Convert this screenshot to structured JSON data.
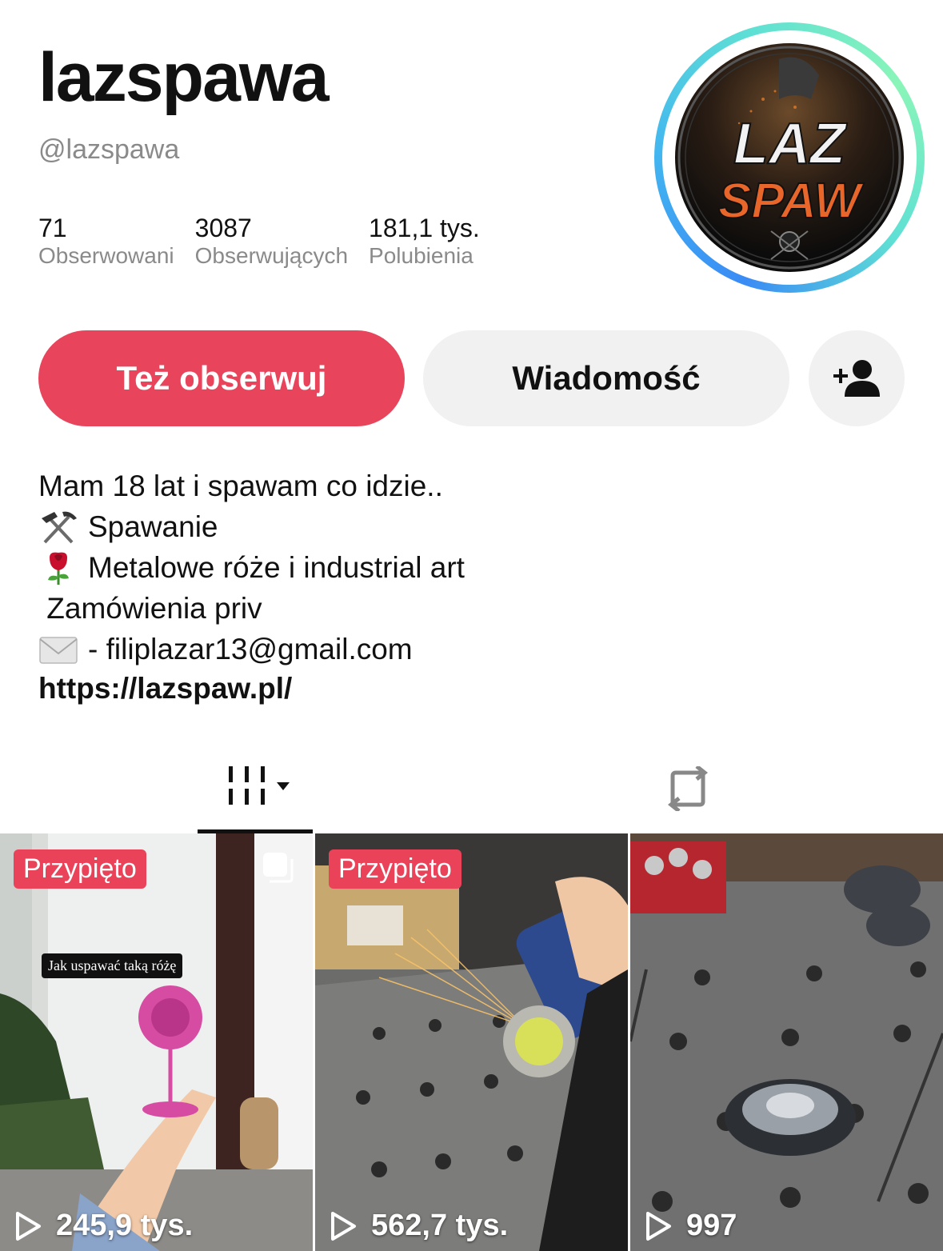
{
  "profile": {
    "display_name": "lazspawa",
    "handle": "@lazspawa",
    "avatar_text_top": "LAZ",
    "avatar_text_bottom": "SPAW"
  },
  "stats": [
    {
      "value": "71",
      "label": "Obserwowani"
    },
    {
      "value": "3087",
      "label": "Obserwujących"
    },
    {
      "value": "181,1 tys.",
      "label": "Polubienia"
    }
  ],
  "actions": {
    "follow_label": "Też obserwuj",
    "message_label": "Wiadomość",
    "add_friend_icon": "add-user-icon"
  },
  "bio": {
    "lines": [
      "Mam 18 lat i spawam co idzie..",
      "Spawanie",
      "Metalowe róże i industrial art",
      " Zamówienia priv",
      "- filiplazar13@gmail.com"
    ],
    "link": "https://lazspaw.pl/"
  },
  "tabs": {
    "videos_icon": "grid-icon",
    "reposts_icon": "repost-icon"
  },
  "videos": [
    {
      "pinned": "Przypięto",
      "views": "245,9 tys.",
      "caption": "Jak uspawać taką różę"
    },
    {
      "pinned": "Przypięto",
      "views": "562,7 tys."
    },
    {
      "views": "997"
    }
  ],
  "colors": {
    "accent": "#e8455c",
    "pinned_badge": "#ea4359",
    "muted_text": "#8a8a8a",
    "button_gray": "#f1f1f1"
  }
}
